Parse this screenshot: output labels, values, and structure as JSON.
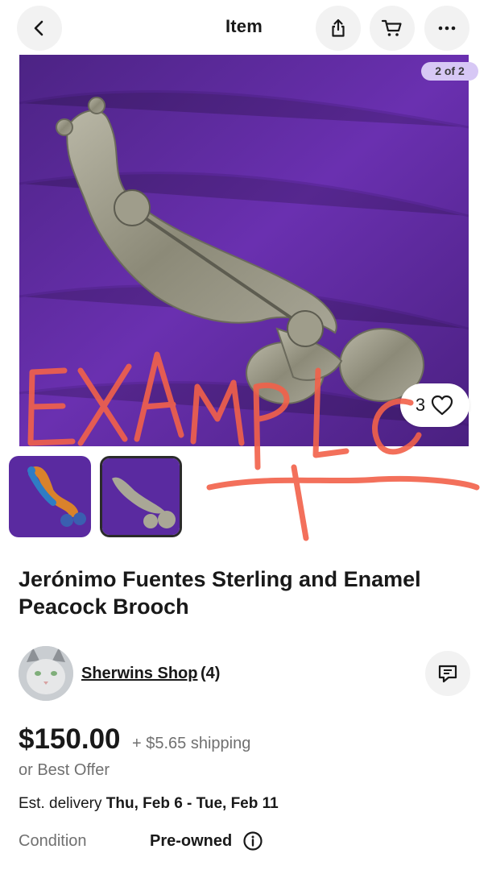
{
  "header": {
    "title": "Item",
    "icons": [
      "chevron-left-icon",
      "share-icon",
      "cart-icon",
      "more-icon"
    ]
  },
  "gallery": {
    "page_indicator": "2 of 2",
    "watch_count": "3",
    "watermark_text": "EXAMPLE",
    "colors": {
      "background_purple": "#5b2a9a",
      "watermark_red": "#f2614a",
      "badge": "#d7c8f5"
    }
  },
  "listing": {
    "title": "Jerónimo Fuentes Sterling and Enamel Peacock Brooch"
  },
  "seller": {
    "name": "Sherwins Shop",
    "feedback_count": "(4)"
  },
  "pricing": {
    "price": "$150.00",
    "shipping": "+ $5.65 shipping",
    "best_offer": "or Best Offer",
    "delivery_label": "Est. delivery",
    "delivery_dates": "Thu, Feb 6 - Tue, Feb 11",
    "condition_label": "Condition",
    "condition_value": "Pre-owned"
  }
}
